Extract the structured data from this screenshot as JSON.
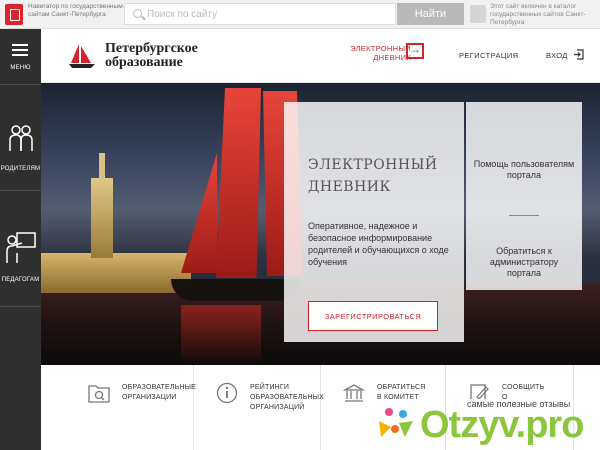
{
  "topbar": {
    "gov_text": "Навигатор по государственным сайтам Санкт-Петербурга",
    "search_placeholder": "Поиск по сайту",
    "search_button": "Найти",
    "catalog_text": "Этот сайт включен в каталог государственных сайтов Санкт-Петербурга"
  },
  "sidebar": {
    "menu": "МЕНЮ",
    "parents": "РОДИТЕЛЯМ",
    "teachers": "ПЕДАГОГАМ"
  },
  "header": {
    "logo_line1": "Петербургское",
    "logo_line2": "образование",
    "ediary_line1": "ЭЛЕКТРОННЫЙ",
    "ediary_line2": "ДНЕВНИК",
    "register": "РЕГИСТРАЦИЯ",
    "login": "ВХОД"
  },
  "hero": {
    "title_line1": "ЭЛЕКТРОННЫЙ",
    "title_line2": "ДНЕВНИК",
    "description": "Оперативное, надежное и безопасное информирование родителей и обучающихся о ходе обучения",
    "register_button": "ЗАРЕГИСТРИРОВАТЬСЯ",
    "help_users": "Помощь пользователям портала",
    "contact_admin": "Обратиться к администратору портала"
  },
  "bottom": {
    "items": [
      {
        "line1": "ОБРАЗОВАТЕЛЬНЫЕ",
        "line2": "ОРГАНИЗАЦИИ",
        "line3": ""
      },
      {
        "line1": "РЕЙТИНГИ",
        "line2": "ОБРАЗОВАТЕЛЬНЫХ",
        "line3": "ОРГАНИЗАЦИЙ"
      },
      {
        "line1": "ОБРАТИТЬСЯ",
        "line2": "В КОМИТЕТ",
        "line3": ""
      },
      {
        "line1": "СООБЩИТЬ",
        "line2": "О",
        "line3": ""
      }
    ]
  },
  "watermark": {
    "subtitle": "самые полезные отзывы",
    "brand": "Otzyv.pro"
  },
  "colors": {
    "accent_red": "#d3242b",
    "sidebar_bg": "#2f2f2f",
    "watermark_green": "#8cc63e"
  }
}
